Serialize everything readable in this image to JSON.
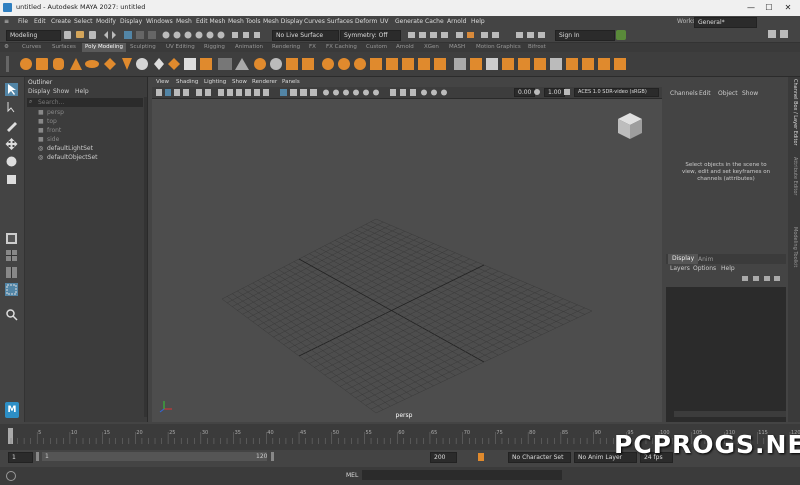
{
  "window": {
    "title": "untitled - Autodesk MAYA 2027: untitled",
    "minimize": "—",
    "maximize": "☐",
    "close": "✕"
  },
  "menu": [
    "File",
    "Edit",
    "Create",
    "Select",
    "Modify",
    "Display",
    "Windows",
    "Mesh",
    "Edit Mesh",
    "Mesh Tools",
    "Mesh Display",
    "Curves",
    "Surfaces",
    "Deform",
    "UV",
    "Generate",
    "Cache",
    "Arnold",
    "Help"
  ],
  "workspace": {
    "label": "Workspace :",
    "value": "General*"
  },
  "status": {
    "mode": "Modeling",
    "live_surface": "No Live Surface",
    "symmetry": "Symmetry: Off",
    "sign_in": "Sign In"
  },
  "shelf_tabs": [
    "Curves",
    "Surfaces",
    "Poly Modeling",
    "Sculpting",
    "UV Editing",
    "Rigging",
    "Animation",
    "Rendering",
    "FX",
    "FX Caching",
    "Custom",
    "Arnold",
    "XGen",
    "MASH",
    "Motion Graphics",
    "Bifrost"
  ],
  "shelf_active": "Poly Modeling",
  "outliner": {
    "title": "Outliner",
    "menu": [
      "Display",
      "Show",
      "Help"
    ],
    "search_placeholder": "Search...",
    "items": [
      "persp",
      "top",
      "front",
      "side",
      "defaultLightSet",
      "defaultObjectSet"
    ]
  },
  "viewport": {
    "menu": [
      "View",
      "Shading",
      "Lighting",
      "Show",
      "Renderer",
      "Panels"
    ],
    "value1": "0.00",
    "value2": "1.00",
    "colorspace": "ACES 1.0 SDR-video (sRGB)",
    "camera": "persp"
  },
  "channelbox": {
    "menu": [
      "Channels",
      "Edit",
      "Object",
      "Show"
    ],
    "hint": "Select objects in the scene to view, edit and set keyframes on channels (attributes)",
    "layer_tabs": [
      "Display",
      "Anim"
    ],
    "layer_menu": [
      "Layers",
      "Options",
      "Help"
    ],
    "side_tabs": [
      "Channel Box / Layer Editor",
      "Attribute Editor",
      "Modeling Toolkit"
    ]
  },
  "timeline": {
    "ticks": [
      "5",
      "10",
      "15",
      "20",
      "25",
      "30",
      "35",
      "40",
      "45",
      "50",
      "55",
      "60",
      "65",
      "70",
      "75",
      "80",
      "85",
      "90",
      "95",
      "100",
      "105",
      "110",
      "115",
      "120"
    ],
    "current_frame": "1"
  },
  "range": {
    "start": "1",
    "inner_start": "1",
    "inner_end": "120",
    "end": "200",
    "character_set": "No Character Set",
    "anim_layer": "No Anim Layer",
    "fps": "24 fps"
  },
  "mel": {
    "label": "MEL"
  },
  "watermark": "PCPROGS.NET",
  "colors": {
    "accent": "#d98a3a",
    "shelf_orange": "#e08a2d",
    "select_blue": "#5285a6"
  }
}
